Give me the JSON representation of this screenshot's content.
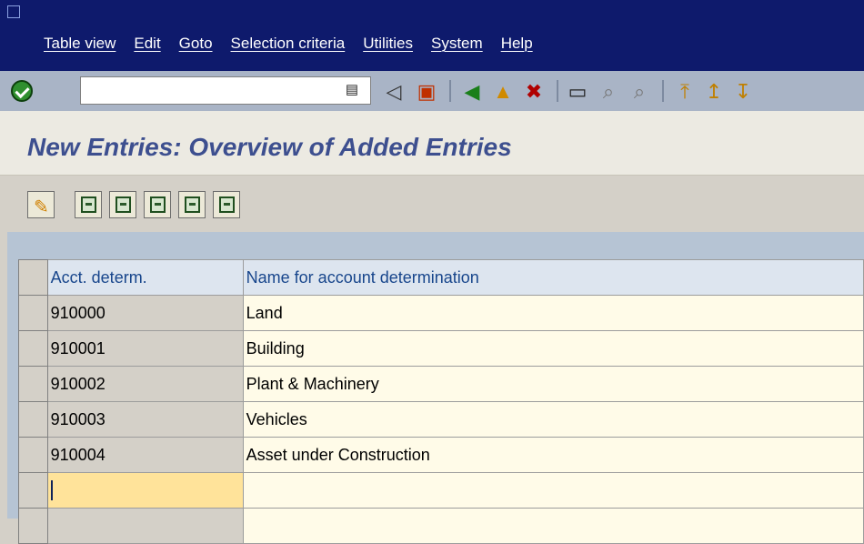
{
  "menu": [
    "Table view",
    "Edit",
    "Goto",
    "Selection criteria",
    "Utilities",
    "System",
    "Help"
  ],
  "title": "New Entries: Overview of Added Entries",
  "toolbar_icons": [
    "back",
    "save",
    "green-back",
    "exit",
    "cancel",
    "print",
    "find",
    "find-next",
    "first-page",
    "previous-page"
  ],
  "table": {
    "headers": [
      "Acct. determ.",
      "Name for account determination"
    ],
    "rows": [
      {
        "code": "910000",
        "name": "Land"
      },
      {
        "code": "910001",
        "name": "Building"
      },
      {
        "code": "910002",
        "name": "Plant & Machinery"
      },
      {
        "code": "910003",
        "name": "Vehicles"
      },
      {
        "code": "910004",
        "name": "Asset under Construction"
      }
    ]
  }
}
